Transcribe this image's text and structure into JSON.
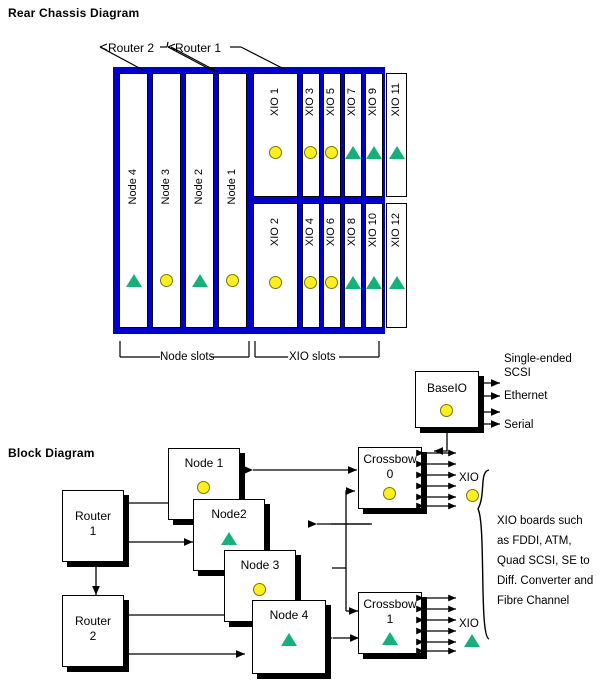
{
  "sections": {
    "rear_title": "Rear Chassis Diagram",
    "block_title": "Block Diagram"
  },
  "colors": {
    "chassis_frame": "#0000cc",
    "marker_yellow": "#ffee22",
    "marker_green": "#16b07a",
    "box_border": "#000000",
    "background": "#ffffff"
  },
  "rear_chassis": {
    "callouts": [
      {
        "label": "Router 2"
      },
      {
        "label": "Router 1"
      }
    ],
    "node_slots": [
      {
        "label": "Node 4",
        "marker": "triangle"
      },
      {
        "label": "Node 3",
        "marker": "circle"
      },
      {
        "label": "Node 2",
        "marker": "triangle"
      },
      {
        "label": "Node 1",
        "marker": "circle"
      }
    ],
    "xio_slots_top": [
      {
        "label": "XIO 1",
        "marker": "circle",
        "wide": true
      },
      {
        "label": "XIO 3",
        "marker": "circle",
        "wide": false
      },
      {
        "label": "XIO 5",
        "marker": "circle",
        "wide": false
      },
      {
        "label": "XIO 7",
        "marker": "triangle",
        "wide": false
      },
      {
        "label": "XIO 9",
        "marker": "triangle",
        "wide": false
      },
      {
        "label": "XIO 11",
        "marker": "triangle",
        "wide": false
      }
    ],
    "xio_slots_bottom": [
      {
        "label": "XIO 2",
        "marker": "circle",
        "wide": true
      },
      {
        "label": "XIO 4",
        "marker": "circle",
        "wide": false
      },
      {
        "label": "XIO 6",
        "marker": "circle",
        "wide": false
      },
      {
        "label": "XIO 8",
        "marker": "triangle",
        "wide": false
      },
      {
        "label": "XIO 10",
        "marker": "triangle",
        "wide": false
      },
      {
        "label": "XIO 12",
        "marker": "triangle",
        "wide": false
      }
    ],
    "brace_labels": {
      "node": "Node slots",
      "xio": "XIO slots"
    }
  },
  "block_diagram": {
    "baseio": {
      "label": "BaseIO",
      "marker": "circle",
      "ports": [
        "Single-ended",
        "SCSI",
        "Ethernet",
        "Serial"
      ],
      "port_lines": [
        {
          "line1": "Single-ended",
          "line2": "SCSI"
        },
        {
          "line1": "Ethernet",
          "line2": ""
        },
        {
          "line1": "Serial",
          "line2": ""
        }
      ]
    },
    "routers": [
      {
        "label": "Router",
        "label2": "1",
        "marker": "none"
      },
      {
        "label": "Router",
        "label2": "2",
        "marker": "none"
      }
    ],
    "nodes": [
      {
        "label": "Node 1",
        "marker": "circle"
      },
      {
        "label": "Node2",
        "marker": "triangle"
      },
      {
        "label": "Node 3",
        "marker": "circle"
      },
      {
        "label": "Node 4",
        "marker": "triangle"
      }
    ],
    "crossbows": [
      {
        "label": "Crossbow",
        "label2": "0",
        "marker": "circle"
      },
      {
        "label": "Crossbow",
        "label2": "1",
        "marker": "triangle"
      }
    ],
    "xio_tags": [
      {
        "label": "XIO",
        "marker": "circle"
      },
      {
        "label": "XIO",
        "marker": "triangle"
      }
    ],
    "xio_note": {
      "lines": [
        "XIO boards such",
        "as FDDI, ATM,",
        "Quad SCSI, SE to",
        "Diff. Converter and",
        "Fibre Channel"
      ]
    }
  }
}
